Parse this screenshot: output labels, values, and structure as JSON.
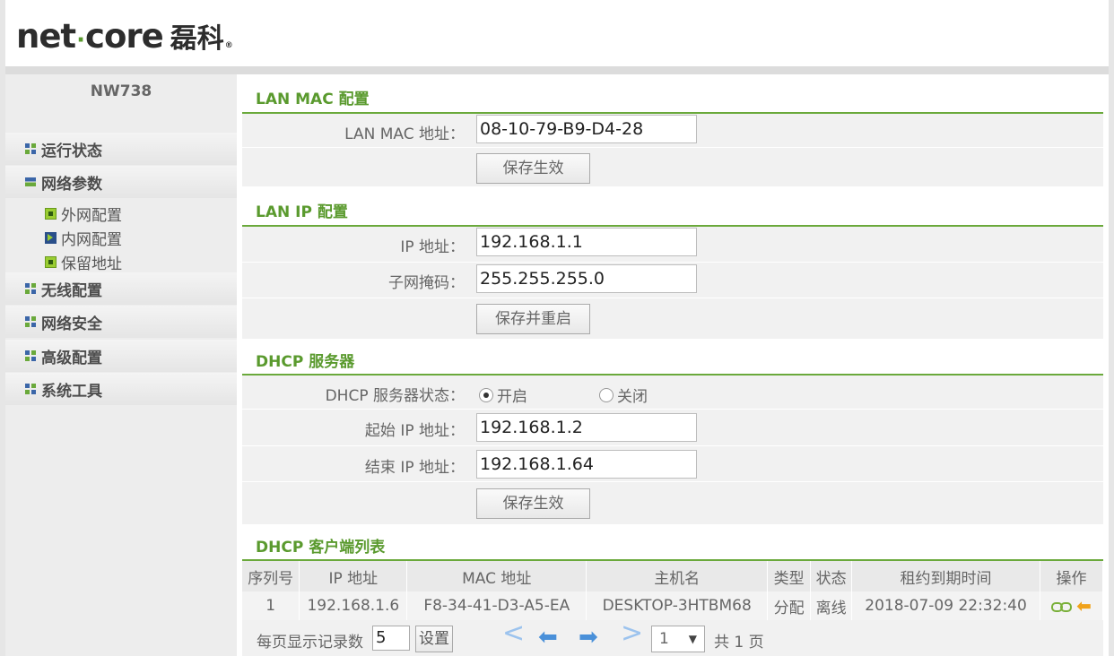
{
  "brand": {
    "name_prefix": "net",
    "name_suffix": "core",
    "cn": "磊科",
    "reg": "®"
  },
  "sidebar": {
    "model": "NW738",
    "items": [
      {
        "label": "运行状态",
        "expanded": false
      },
      {
        "label": "网络参数",
        "expanded": true
      },
      {
        "label": "无线配置",
        "expanded": false
      },
      {
        "label": "网络安全",
        "expanded": false
      },
      {
        "label": "高级配置",
        "expanded": false
      },
      {
        "label": "系统工具",
        "expanded": false
      }
    ],
    "subitems": [
      {
        "label": "外网配置",
        "icon": "green-square-icon"
      },
      {
        "label": "内网配置",
        "icon": "blue-arrow-icon",
        "active": true
      },
      {
        "label": "保留地址",
        "icon": "green-square-icon"
      }
    ]
  },
  "lan_mac": {
    "title": "LAN MAC 配置",
    "mac_label": "LAN MAC 地址：",
    "mac_value": "08-10-79-B9-D4-28",
    "save_label": "保存生效"
  },
  "lan_ip": {
    "title": "LAN IP 配置",
    "ip_label": "IP 地址：",
    "ip_value": "192.168.1.1",
    "mask_label": "子网掩码：",
    "mask_value": "255.255.255.0",
    "save_label": "保存并重启"
  },
  "dhcp": {
    "title": "DHCP 服务器",
    "status_label": "DHCP 服务器状态：",
    "on_label": "开启",
    "off_label": "关闭",
    "enabled": true,
    "start_label": "起始 IP 地址：",
    "start_value": "192.168.1.2",
    "end_label": "结束 IP 地址：",
    "end_value": "192.168.1.64",
    "save_label": "保存生效"
  },
  "clients": {
    "title": "DHCP 客户端列表",
    "columns": [
      "序列号",
      "IP 地址",
      "MAC 地址",
      "主机名",
      "类型",
      "状态",
      "租约到期时间",
      "操作"
    ],
    "rows": [
      [
        "1",
        "192.168.1.6",
        "F8-34-41-D3-A5-EA",
        "DESKTOP-3HTBM68",
        "分配",
        "离线",
        "2018-07-09 22:32:40"
      ]
    ],
    "per_page_label": "每页显示记录数",
    "per_page_value": "5",
    "set_label": "设置",
    "page_value": "1",
    "total_label": "共 1 页"
  },
  "colors": {
    "accent_green": "#5a9a2e",
    "nav_blue": "#4a90d9",
    "action_orange": "#f0a21a"
  }
}
